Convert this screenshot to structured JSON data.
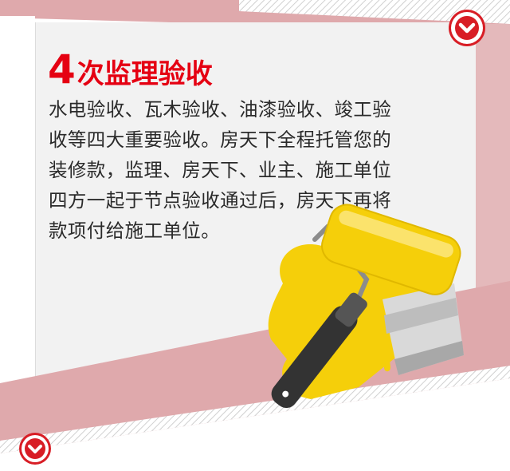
{
  "header": {
    "title_number": "4",
    "title_text": "次监理验收"
  },
  "content": {
    "lines": [
      "水电验收、瓦木验收、油漆验收、竣工验",
      "收等四大重要验收。房天下全程托管您的",
      "装修款，监理、房天下、业主、施工单位",
      "四方一起于节点验收通过后，房天下再将",
      "款项付给施工单位。"
    ]
  },
  "icons": {
    "top_button": "chevron-down-icon",
    "bottom_button": "chevron-down-icon",
    "illustration": "paint-roller-icon"
  },
  "colors": {
    "accent": "#e50012",
    "button": "#d81d25",
    "pink_band": "#dfa9ac",
    "paint_yellow": "#f5cf0a",
    "card": "#f2f2f2"
  }
}
